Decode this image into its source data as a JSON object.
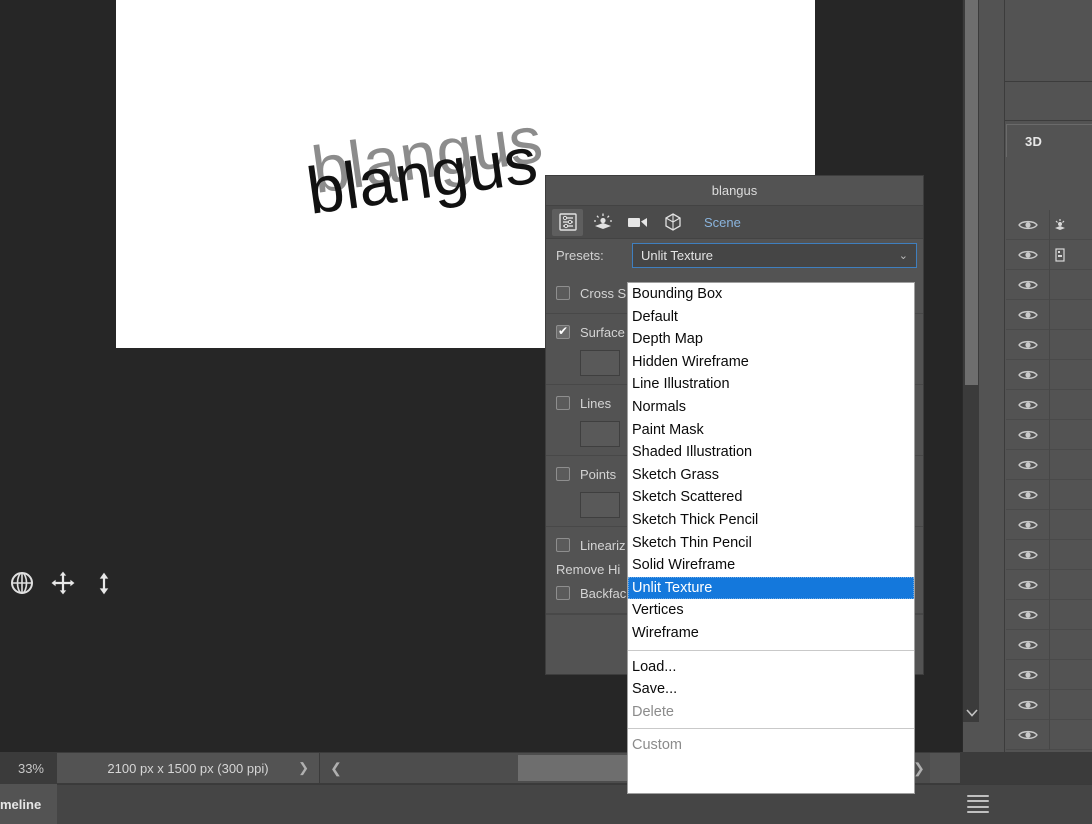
{
  "document": {
    "artwork_text": "blangus",
    "canvas_bg": "#ffffff",
    "extrude_color": "#8c8c8c",
    "face_color": "#1a1a1a"
  },
  "tools_3d": [
    {
      "name": "orbit-3d-camera-tool",
      "glyph": "orbit"
    },
    {
      "name": "pan-3d-camera-tool",
      "glyph": "pan"
    },
    {
      "name": "slide-3d-camera-tool",
      "glyph": "slide"
    }
  ],
  "statusbar": {
    "zoom": "33%",
    "dimensions": "2100 px x 1500 px (300 ppi)",
    "dims_chevron": "❯",
    "scroll_left_arrow": "❮",
    "scroll_right_arrow": "❯"
  },
  "timeline": {
    "tab_label": "meline",
    "menu_icon": "hamburger-menu-icon"
  },
  "right_dock": {
    "panel_title": "3D",
    "rows": [
      {
        "eye": "visibility-eye-icon",
        "item": "scene-light-icon"
      },
      {
        "eye": "visibility-eye-icon",
        "item": "mesh-icon"
      },
      {
        "eye": "visibility-eye-icon",
        "item": ""
      },
      {
        "eye": "visibility-eye-icon",
        "item": ""
      },
      {
        "eye": "visibility-eye-icon",
        "item": ""
      },
      {
        "eye": "visibility-eye-icon",
        "item": ""
      },
      {
        "eye": "visibility-eye-icon",
        "item": ""
      },
      {
        "eye": "visibility-eye-icon",
        "item": ""
      },
      {
        "eye": "visibility-eye-icon",
        "item": ""
      },
      {
        "eye": "visibility-eye-icon",
        "item": ""
      },
      {
        "eye": "visibility-eye-icon",
        "item": ""
      },
      {
        "eye": "visibility-eye-icon",
        "item": ""
      },
      {
        "eye": "visibility-eye-icon",
        "item": ""
      },
      {
        "eye": "visibility-eye-icon",
        "item": ""
      },
      {
        "eye": "visibility-eye-icon",
        "item": ""
      },
      {
        "eye": "visibility-eye-icon",
        "item": ""
      },
      {
        "eye": "visibility-eye-icon",
        "item": ""
      },
      {
        "eye": "visibility-eye-icon",
        "item": ""
      }
    ]
  },
  "panel_3d": {
    "title": "blangus",
    "tabs": [
      {
        "name": "scene-filter-icon",
        "active": true
      },
      {
        "name": "lights-filter-icon",
        "active": false
      },
      {
        "name": "camera-filter-icon",
        "active": false
      },
      {
        "name": "mesh-filter-icon",
        "active": false
      }
    ],
    "scene_label": "Scene",
    "presets": {
      "label": "Presets:",
      "value": "Unlit Texture",
      "caret": "⌄"
    },
    "options": [
      {
        "label": "Cross S",
        "checked": false,
        "swatch": false
      },
      {
        "label": "Surface",
        "checked": true,
        "swatch": true
      },
      {
        "label": "Lines",
        "checked": false,
        "swatch": true
      },
      {
        "label": "Points",
        "checked": false,
        "swatch": true
      }
    ],
    "extra_options": [
      {
        "label": "Lineariz",
        "checked": false
      },
      {
        "label": "Remove Hi",
        "checked": null
      },
      {
        "label": "Backfac",
        "checked": false
      }
    ]
  },
  "dropdown": {
    "items": [
      "Bounding Box",
      "Default",
      "Depth Map",
      "Hidden Wireframe",
      "Line Illustration",
      "Normals",
      "Paint Mask",
      "Shaded Illustration",
      "Sketch Grass",
      "Sketch Scattered",
      "Sketch Thick Pencil",
      "Sketch Thin Pencil",
      "Solid Wireframe",
      "Unlit Texture",
      "Vertices",
      "Wireframe"
    ],
    "selected": "Unlit Texture",
    "actions": [
      {
        "label": "Load...",
        "disabled": false
      },
      {
        "label": "Save...",
        "disabled": false
      },
      {
        "label": "Delete",
        "disabled": true
      }
    ],
    "footer": {
      "label": "Custom",
      "disabled": true
    }
  },
  "colors": {
    "app_bg": "#262626",
    "panel_bg": "#535353",
    "panel_bg_alt": "#454545",
    "accent_blue": "#1478dc",
    "focus_blue": "#3f7fbf",
    "text": "#d4d4d4",
    "link_blue": "#8ab4dd"
  }
}
